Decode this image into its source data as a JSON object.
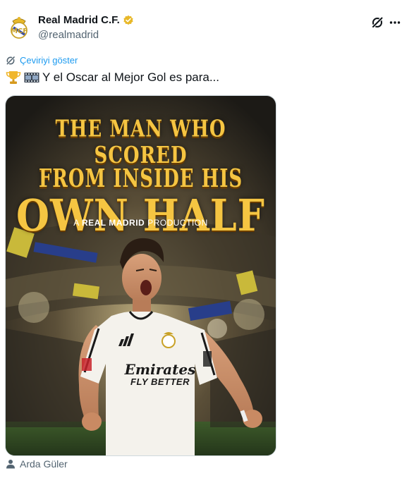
{
  "author": {
    "display_name": "Real Madrid C.F.",
    "handle": "@realmadrid"
  },
  "actions": {
    "grok_icon": "grok-icon",
    "more_icon": "more-icon"
  },
  "translate": {
    "label": "Çeviriyi göster"
  },
  "tweet": {
    "text": "Y el Oscar al Mejor Gol es para..."
  },
  "media": {
    "headline_line1": "THE MAN WHO SCORED",
    "headline_line2": "FROM INSIDE HIS",
    "headline_line3": "OWN HALF",
    "production_prefix": "A",
    "production_brand": "REAL MADRID",
    "production_suffix": "PRODUCTION",
    "shirt_sponsor": "Emirates",
    "shirt_tagline": "FLY BETTER"
  },
  "tagged_user": {
    "name": "Arda Güler"
  },
  "colors": {
    "link_blue": "#1d9bf0",
    "verified_gold": "#e8b829",
    "headline_gold": "#f5c542",
    "secondary_text": "#536471"
  }
}
